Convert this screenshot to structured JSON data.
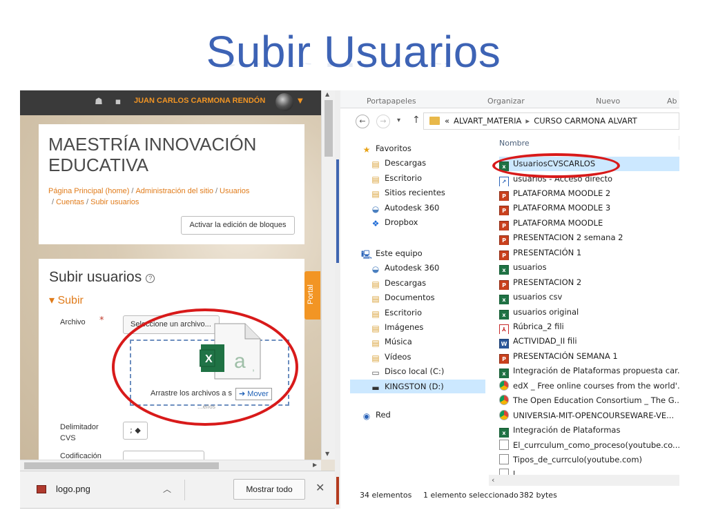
{
  "slide": {
    "title": "Subir Usuarios"
  },
  "browser": {
    "topbar": {
      "user_name": "JUAN CARLOS CARMONA RENDÓN"
    },
    "site_title": "MAESTRÍA INNOVACIÓN EDUCATIVA",
    "breadcrumb": [
      "Página Principal (home)",
      "Administración del sitio",
      "Usuarios",
      "Cuentas",
      "Subir usuarios"
    ],
    "edit_blocks_button": "Activar la edición de bloques",
    "section_title": "Subir usuarios",
    "help_icon": "?",
    "collapse_label": "Subir",
    "file_label": "Archivo",
    "required_mark": "*",
    "select_file_button": "Seleccione un archivo...",
    "drop_text": "Arrastre los archivos a s",
    "move_tooltip": "Mover",
    "drop_ghost": "...ellos",
    "delimiter_label": "Delimitador CVS",
    "delimiter_value": ";",
    "encoding_label": "Codificación",
    "portal_tab": "Portal",
    "downloads": {
      "file": "logo.png",
      "show_all": "Mostrar todo",
      "close": "✕"
    },
    "icons": [
      "bell-icon",
      "chat-icon",
      "avatar",
      "caret-down-icon",
      "excel-file-icon"
    ]
  },
  "explorer": {
    "ribbon": [
      "Portapapeles",
      "Organizar",
      "Nuevo",
      "Ab"
    ],
    "path": [
      "ALVART_MATERIA",
      "CURSO CARMONA ALVART"
    ],
    "nav_groups": [
      {
        "label": "Favoritos",
        "icon": "star",
        "items": [
          "Descargas",
          "Escritorio",
          "Sitios recientes",
          "Autodesk 360",
          "Dropbox"
        ]
      },
      {
        "label": "Este equipo",
        "icon": "computer",
        "items": [
          "Autodesk 360",
          "Descargas",
          "Documentos",
          "Escritorio",
          "Imágenes",
          "Música",
          "Vídeos",
          "Disco local (C:)",
          "KINGSTON (D:)"
        ]
      },
      {
        "label": "Red",
        "icon": "network",
        "items": []
      }
    ],
    "selected_nav": "KINGSTON (D:)",
    "column_header": "Nombre",
    "files": [
      {
        "name": "UsuariosCVSCARLOS",
        "type": "excel"
      },
      {
        "name": "usuarios - Acceso directo",
        "type": "lnk"
      },
      {
        "name": "PLATAFORMA MOODLE 2",
        "type": "ppt"
      },
      {
        "name": "PLATAFORMA MOODLE 3",
        "type": "ppt"
      },
      {
        "name": "PLATAFORMA MOODLE",
        "type": "ppt"
      },
      {
        "name": "PRESENTACION 2 semana 2",
        "type": "ppt"
      },
      {
        "name": "PRESENTACIÓN 1",
        "type": "ppt"
      },
      {
        "name": "usuarios",
        "type": "excel"
      },
      {
        "name": "PRESENTACION 2",
        "type": "ppt"
      },
      {
        "name": "usuarios csv",
        "type": "excel"
      },
      {
        "name": "usuarios original",
        "type": "excel"
      },
      {
        "name": "Rúbrica_2 fili",
        "type": "pdf"
      },
      {
        "name": "ACTIVIDAD_II fili",
        "type": "word"
      },
      {
        "name": "PRESENTACIÓN SEMANA 1",
        "type": "ppt"
      },
      {
        "name": "Integración de Plataformas propuesta car...",
        "type": "excel"
      },
      {
        "name": "edX _ Free online courses from the world'...",
        "type": "chrome"
      },
      {
        "name": "The Open Education Consortium _ The G...",
        "type": "chrome"
      },
      {
        "name": "UNIVERSIA-MIT-OPENCOURSEWARE-VE...",
        "type": "chrome"
      },
      {
        "name": "Integración de Plataformas",
        "type": "excel"
      },
      {
        "name": "El_currculum_como_proceso(youtube.co...",
        "type": "txt"
      },
      {
        "name": "Tipos_de_currculo(youtube.com)",
        "type": "txt"
      },
      {
        "name": "l ...",
        "type": "txt"
      }
    ],
    "selected_file": "UsuariosCVSCARLOS",
    "status": {
      "count": "34 elementos",
      "selected": "1 elemento seleccionado",
      "size": "382 bytes"
    }
  },
  "colors": {
    "title": "#3d63b5",
    "moodle_orange": "#e07b1a",
    "highlight_ellipse": "#d81a1a",
    "selection": "#cce8ff"
  }
}
